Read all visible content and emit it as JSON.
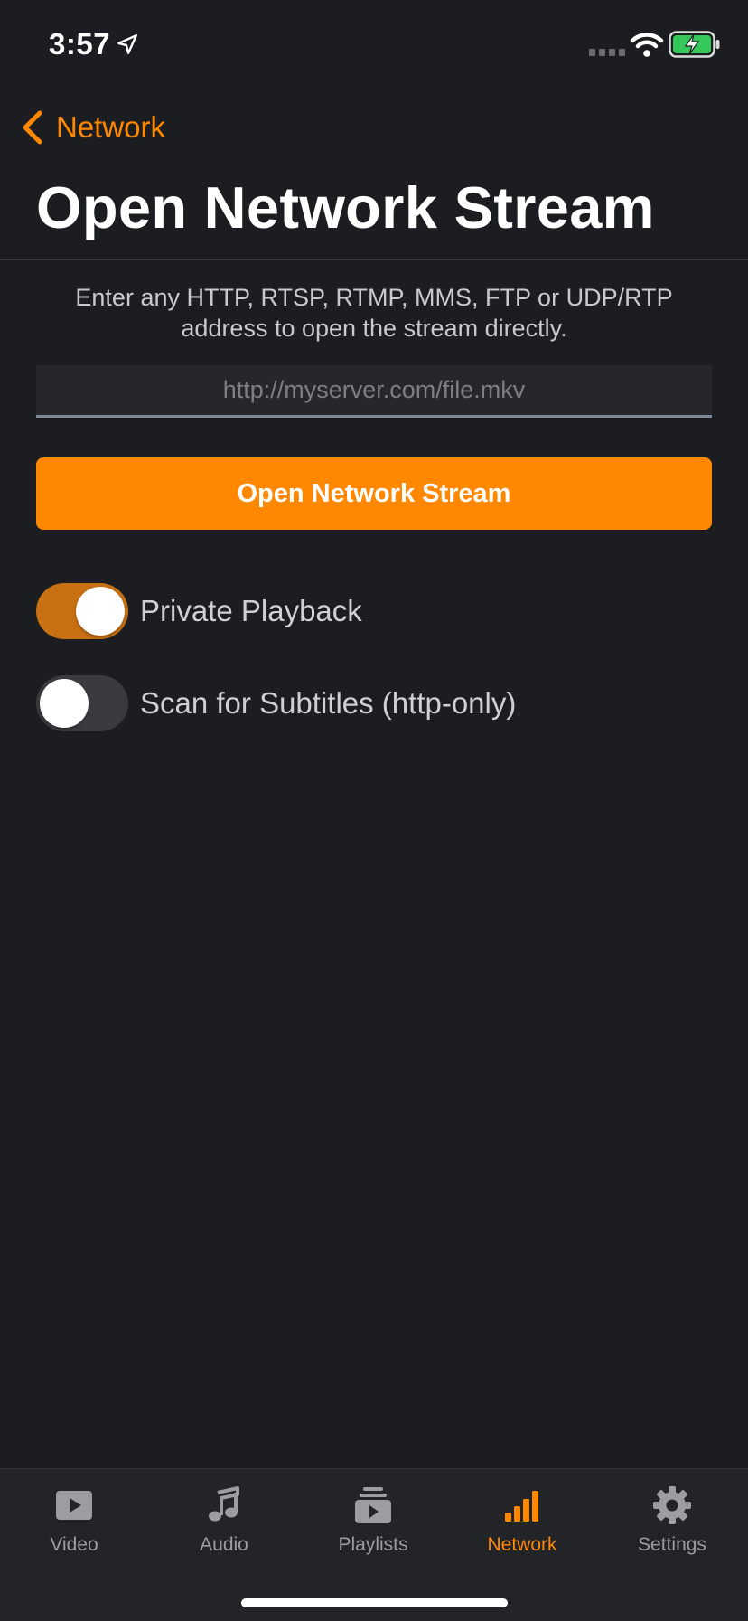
{
  "status_bar": {
    "time": "3:57"
  },
  "nav": {
    "back_label": "Network"
  },
  "page": {
    "title": "Open Network Stream",
    "description": "Enter any HTTP, RTSP, RTMP, MMS, FTP or UDP/RTP address to open the stream directly.",
    "url_input": {
      "placeholder": "http://myserver.com/file.mkv",
      "value": ""
    },
    "open_button_label": "Open Network Stream"
  },
  "toggles": [
    {
      "label": "Private Playback",
      "on": true
    },
    {
      "label": "Scan for Subtitles (http-only)",
      "on": false
    }
  ],
  "tab_bar": {
    "items": [
      {
        "label": "Video",
        "icon": "video-icon",
        "active": false
      },
      {
        "label": "Audio",
        "icon": "music-note-icon",
        "active": false
      },
      {
        "label": "Playlists",
        "icon": "playlist-icon",
        "active": false
      },
      {
        "label": "Network",
        "icon": "network-bars-icon",
        "active": true
      },
      {
        "label": "Settings",
        "icon": "gear-icon",
        "active": false
      }
    ]
  },
  "colors": {
    "accent": "#ff8800",
    "background": "#1b1d20",
    "toggle_on": "#c77014"
  }
}
